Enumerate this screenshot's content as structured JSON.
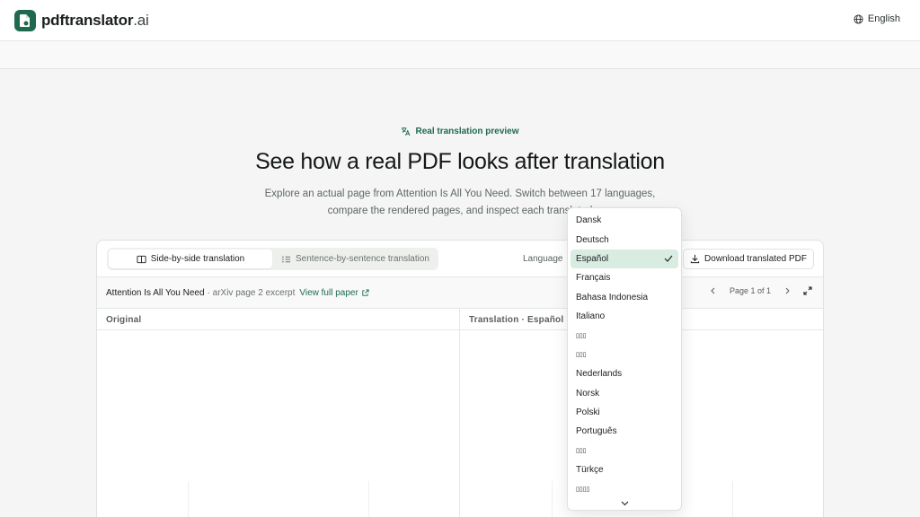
{
  "header": {
    "logo_main": "pdftranslator",
    "logo_tld": ".ai",
    "language": "English"
  },
  "hero": {
    "eyebrow": "Real translation preview",
    "title": "See how a real PDF looks after translation",
    "subtitle_line1": "Explore an actual page from Attention Is All You Need. Switch between 17 languages,",
    "subtitle_line2": "compare the rendered pages, and inspect each translated"
  },
  "toolbar": {
    "mode_side_by_side": "Side-by-side translation",
    "mode_sentence": "Sentence-by-sentence translation",
    "language_label": "Language",
    "download_label": "Download translated PDF"
  },
  "meta": {
    "paper_title": "Attention Is All You Need",
    "paper_detail": "· arXiv page 2 excerpt",
    "link_label": "View full paper",
    "page_indicator": "Page 1 of 1"
  },
  "columns": {
    "original": "Original",
    "translation": "Translation · Español"
  },
  "dropdown": {
    "selected": "Español",
    "options": [
      "Dansk",
      "Deutsch",
      "Español",
      "Français",
      "Bahasa Indonesia",
      "Italiano",
      "▯▯▯",
      "▯▯▯",
      "Nederlands",
      "Norsk",
      "Polski",
      "Português",
      "▯▯▯",
      "Türkçe",
      "▯▯▯▯"
    ]
  },
  "colors": {
    "brand": "#1f6a4f",
    "selected_bg": "#d8ece2"
  }
}
